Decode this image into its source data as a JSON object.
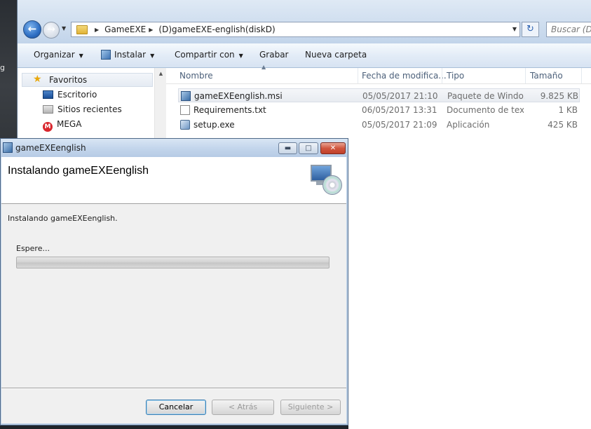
{
  "desktop": {
    "fragment": "g"
  },
  "explorer": {
    "breadcrumb": [
      "GameEXE",
      "(D)gameEXE-english(diskD)"
    ],
    "search_placeholder": "Buscar (D)g",
    "toolbar": {
      "organize": "Organizar",
      "install": "Instalar",
      "share": "Compartir con",
      "burn": "Grabar",
      "new_folder": "Nueva carpeta"
    },
    "nav": {
      "favorites": "Favoritos",
      "items": [
        "Escritorio",
        "Sitios recientes",
        "MEGA"
      ]
    },
    "columns": {
      "name": "Nombre",
      "date": "Fecha de modifica...",
      "type": "Tipo",
      "size": "Tamaño"
    },
    "files": [
      {
        "name": "gameEXEenglish.msi",
        "date": "05/05/2017 21:10",
        "type": "Paquete de Windo...",
        "size": "9.825 KB",
        "icon": "msi-package-icon"
      },
      {
        "name": "Requirements.txt",
        "date": "06/05/2017 13:31",
        "type": "Documento de tex...",
        "size": "1 KB",
        "icon": "text-file-icon"
      },
      {
        "name": "setup.exe",
        "date": "05/05/2017 21:09",
        "type": "Aplicación",
        "size": "425 KB",
        "icon": "setup-exe-icon"
      }
    ]
  },
  "installer": {
    "title": "gameEXEenglish",
    "heading": "Instalando gameEXEenglish",
    "status": "Instalando gameEXEenglish.",
    "wait": "Espere...",
    "progress": 0,
    "buttons": {
      "cancel": "Cancelar",
      "back": "< Atrás",
      "next": "Siguiente >"
    }
  }
}
